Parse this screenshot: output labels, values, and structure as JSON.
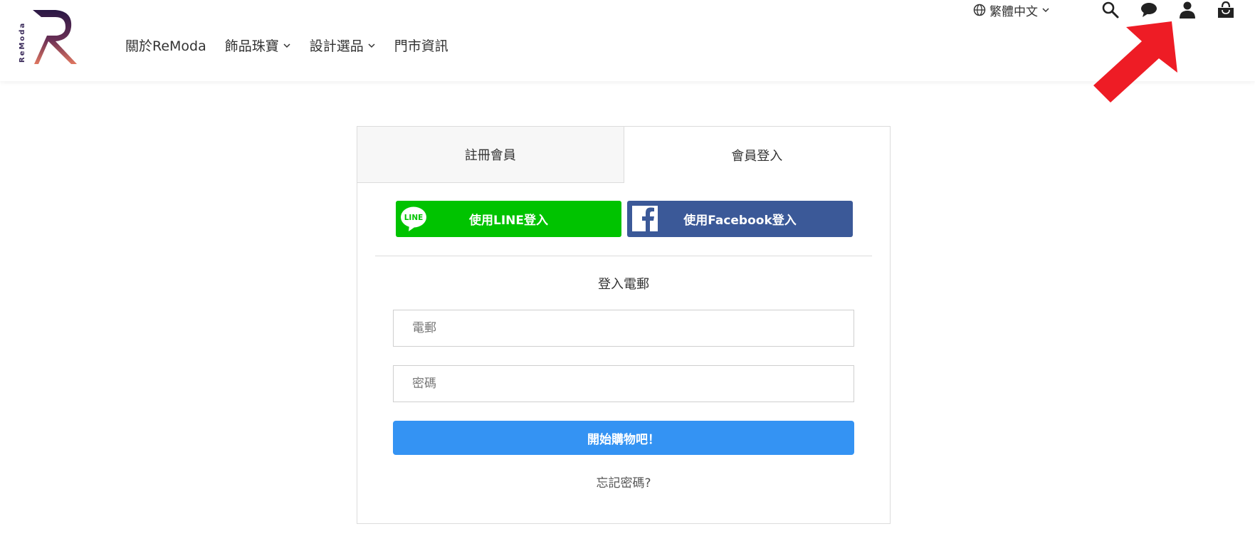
{
  "header": {
    "brand_text": "ReModa",
    "nav": [
      {
        "label": "關於ReModa",
        "has_dropdown": false
      },
      {
        "label": "飾品珠寶",
        "has_dropdown": true
      },
      {
        "label": "設計選品",
        "has_dropdown": true
      },
      {
        "label": "門市資訊",
        "has_dropdown": false
      }
    ],
    "language": "繁體中文",
    "icons": [
      "globe-icon",
      "search-icon",
      "chat-icon",
      "user-icon",
      "cart-icon"
    ]
  },
  "annotation": {
    "arrow_color": "#ee1c25",
    "points_to": "user-icon"
  },
  "login": {
    "tabs": [
      {
        "label": "註冊會員",
        "active": false
      },
      {
        "label": "會員登入",
        "active": true
      }
    ],
    "line_button": {
      "label": "使用LINE登入",
      "icon_text": "LINE",
      "color": "#00c300"
    },
    "facebook_button": {
      "label": "使用Facebook登入",
      "color": "#3b5998"
    },
    "section_title": "登入電郵",
    "email_placeholder": "電郵",
    "password_placeholder": "密碼",
    "submit_label": "開始購物吧！",
    "submit_color": "#3493f3",
    "forgot_label": "忘記密碼?"
  }
}
